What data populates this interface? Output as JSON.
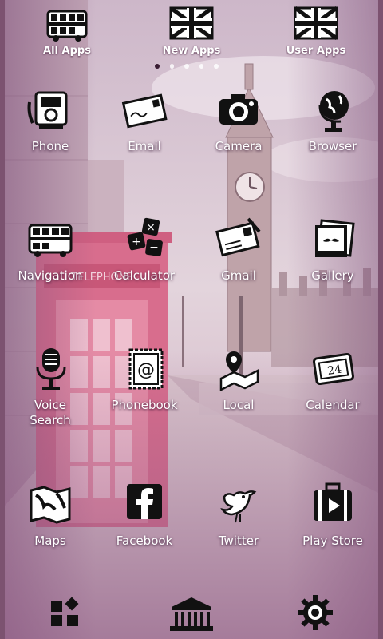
{
  "tabs": [
    {
      "label": "All Apps",
      "icon": "bus-icon"
    },
    {
      "label": "New Apps",
      "icon": "union-jack-icon"
    },
    {
      "label": "User Apps",
      "icon": "union-jack-icon"
    }
  ],
  "page_indicator": {
    "count": 5,
    "active_index": 0
  },
  "apps": [
    {
      "label": "Phone",
      "icon": "telephone-icon"
    },
    {
      "label": "Email",
      "icon": "envelope-icon"
    },
    {
      "label": "Camera",
      "icon": "camera-icon"
    },
    {
      "label": "Browser",
      "icon": "globe-icon"
    },
    {
      "label": "Navigation",
      "icon": "bus-icon"
    },
    {
      "label": "Calculator",
      "icon": "dice-calculator-icon"
    },
    {
      "label": "Gmail",
      "icon": "postcard-icon"
    },
    {
      "label": "Gallery",
      "icon": "photo-mustache-icon"
    },
    {
      "label": "Voice\nSearch",
      "icon": "microphone-icon"
    },
    {
      "label": "Phonebook",
      "icon": "stamp-at-icon"
    },
    {
      "label": "Local",
      "icon": "pin-map-icon"
    },
    {
      "label": "Calendar",
      "icon": "ticket-24-icon"
    },
    {
      "label": "Maps",
      "icon": "map-icon"
    },
    {
      "label": "Facebook",
      "icon": "facebook-icon"
    },
    {
      "label": "Twitter",
      "icon": "bird-icon"
    },
    {
      "label": "Play Store",
      "icon": "suitcase-play-icon"
    }
  ],
  "dock": [
    {
      "icon": "widgets-icon"
    },
    {
      "icon": "museum-icon"
    },
    {
      "icon": "gear-icon"
    }
  ]
}
